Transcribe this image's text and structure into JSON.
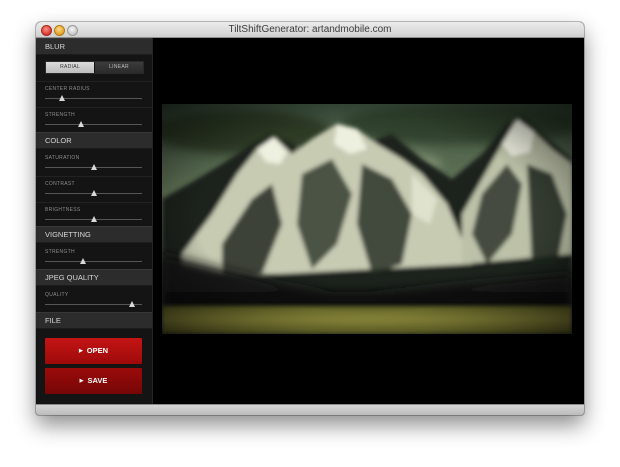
{
  "window": {
    "title": "TiltShiftGenerator: artandmobile.com"
  },
  "sidebar": {
    "blur": {
      "header": "BLUR",
      "modes": [
        "RADIAL",
        "LINEAR"
      ],
      "selected_mode": "RADIAL",
      "center_radius_label": "CENTER RADIUS",
      "center_radius_value": 0.18,
      "strength_label": "STRENGTH",
      "strength_value": 0.37
    },
    "color": {
      "header": "COLOR",
      "saturation_label": "SATURATION",
      "saturation_value": 0.5,
      "contrast_label": "CONTRAST",
      "contrast_value": 0.5,
      "brightness_label": "BRIGHTNESS",
      "brightness_value": 0.5
    },
    "vignetting": {
      "header": "VIGNETTING",
      "strength_label": "STRENGTH",
      "strength_value": 0.39
    },
    "jpeg_quality": {
      "header": "JPEG QUALITY",
      "quality_label": "QUALITY",
      "quality_value": 0.9
    },
    "file": {
      "header": "FILE",
      "open_label": "OPEN",
      "save_label": "SAVE"
    }
  },
  "colors": {
    "open_button": "#c41414",
    "save_button": "#8a0808",
    "sidebar_bg": "#141414",
    "section_header_bg": "#2c2c2c",
    "canvas_bg": "#000000"
  },
  "icons": {
    "button_arrow": "triangle-right-icon"
  }
}
